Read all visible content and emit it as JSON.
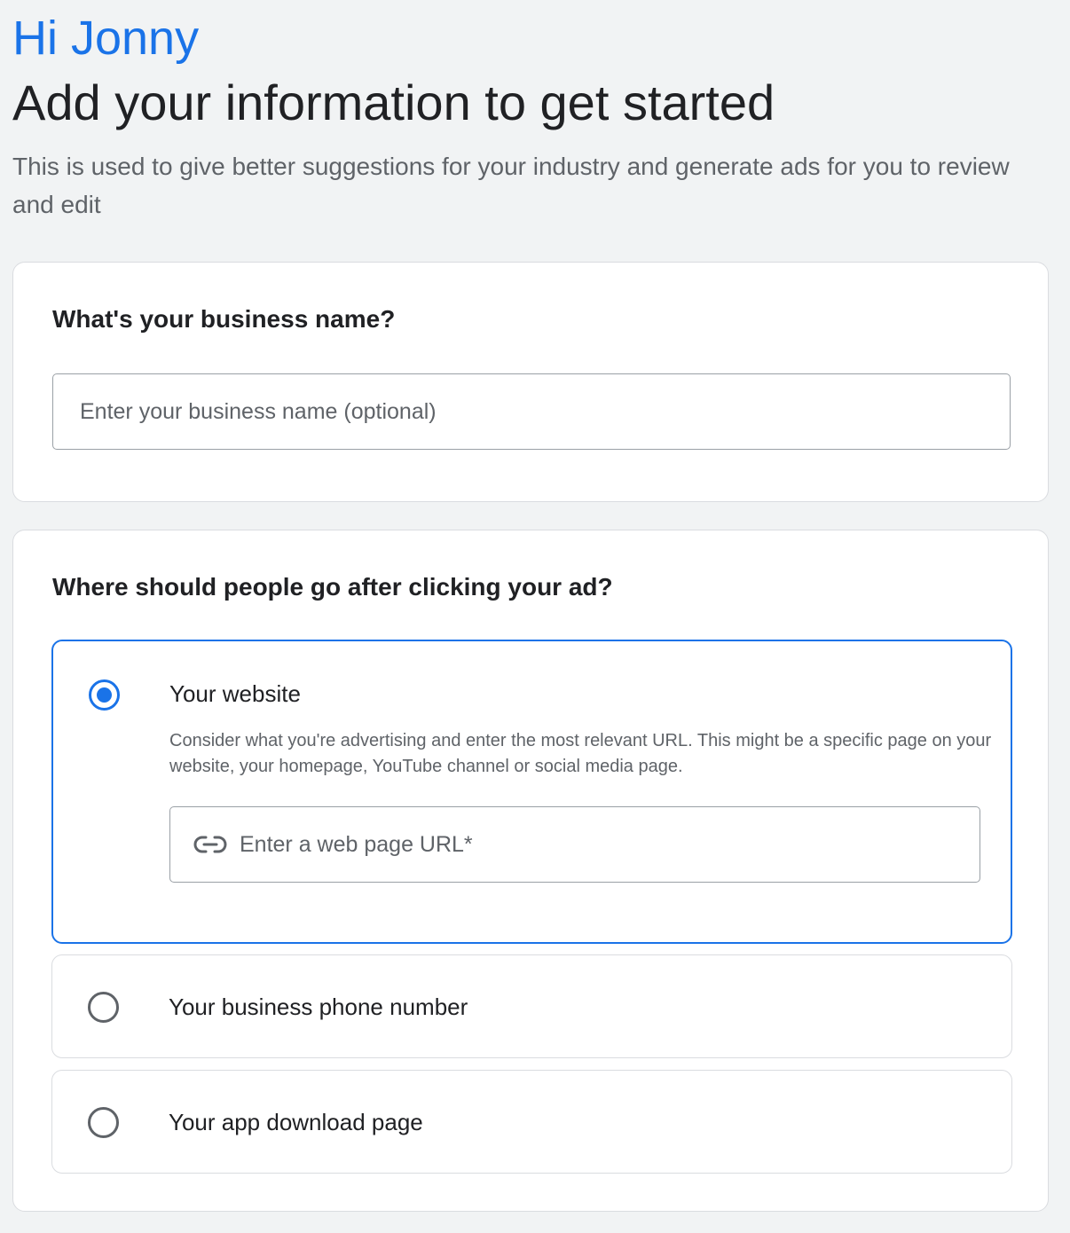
{
  "header": {
    "greeting": "Hi Jonny",
    "title": "Add your information to get started",
    "subtitle": "This is used to give better suggestions for your industry and generate ads for you to review and edit"
  },
  "business_section": {
    "question": "What's your business name?",
    "input_placeholder": "Enter your business name (optional)",
    "input_value": ""
  },
  "destination_section": {
    "question": "Where should people go after clicking your ad?",
    "options": [
      {
        "label": "Your website",
        "selected": true,
        "help": "Consider what you're advertising and enter the most relevant URL. This might be a specific page on your website, your homepage, YouTube channel or social media page.",
        "input_placeholder": "Enter a web page URL*",
        "input_value": "",
        "input_icon": "link-icon"
      },
      {
        "label": "Your business phone number",
        "selected": false
      },
      {
        "label": "Your app download page",
        "selected": false
      }
    ]
  },
  "colors": {
    "accent": "#1a73e8",
    "background": "#f1f3f4",
    "card": "#ffffff",
    "border": "#dadce0",
    "secondary_text": "#5f6368"
  }
}
